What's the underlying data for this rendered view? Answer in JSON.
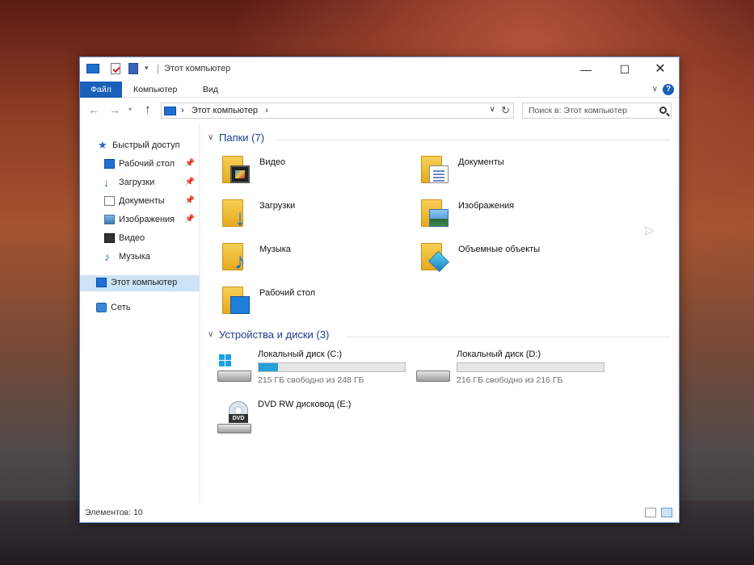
{
  "window": {
    "title": "Этот компьютер"
  },
  "ribbon": {
    "file": "Файл",
    "computer": "Компьютер",
    "view": "Вид",
    "help": "?"
  },
  "address": {
    "path": "Этот компьютер",
    "separator": "›"
  },
  "search": {
    "placeholder": "Поиск в: Этот компьютер"
  },
  "sidebar": {
    "quick_access": "Быстрый доступ",
    "items": [
      {
        "label": "Рабочий стол",
        "pinned": true
      },
      {
        "label": "Загрузки",
        "pinned": true
      },
      {
        "label": "Документы",
        "pinned": true
      },
      {
        "label": "Изображения",
        "pinned": true
      },
      {
        "label": "Видео",
        "pinned": false
      },
      {
        "label": "Музыка",
        "pinned": false
      }
    ],
    "this_pc": "Этот компьютер",
    "network": "Сеть"
  },
  "folders": {
    "header": "Папки (7)",
    "items": [
      "Видео",
      "Документы",
      "Загрузки",
      "Изображения",
      "Музыка",
      "Объемные объекты",
      "Рабочий стол"
    ]
  },
  "devices": {
    "header": "Устройства и диски (3)",
    "items": [
      {
        "label": "Локальный диск (C:)",
        "free": "215 ГБ свободно из 248 ГБ",
        "used_fraction": 0.133
      },
      {
        "label": "Локальный диск (D:)",
        "free": "216 ГБ свободно из 216 ГБ",
        "used_fraction": 0.0
      },
      {
        "label": "DVD RW дисковод (E:)",
        "badge": "DVD"
      }
    ]
  },
  "status": {
    "items_count": "Элементов: 10"
  },
  "colors": {
    "accent": "#1a5fb8",
    "drive_bar": "#26a0da",
    "group_header": "#1d3c8f"
  }
}
